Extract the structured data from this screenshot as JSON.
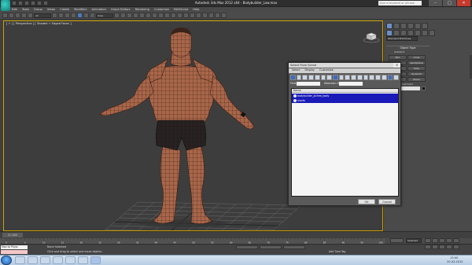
{
  "app": {
    "title": "Autodesk 3ds Max 2012 x64  -  Bodybuilder_Low.max",
    "search_placeholder": "Type a keyword or phrase"
  },
  "window_buttons": [
    "–",
    "□",
    "✕"
  ],
  "menu": [
    "Edit",
    "Tools",
    "Group",
    "Views",
    "Create",
    "Modifiers",
    "Animation",
    "Graph Editors",
    "Rendering",
    "Customize",
    "MAXScript",
    "Help"
  ],
  "toolbar": {
    "selection_filter": "All",
    "view_drop": "View"
  },
  "viewport": {
    "label": "[ + ] [ Perspective ] [ Shaded + Edged Faces ]"
  },
  "command_panel": {
    "dropdown": "Standard Primitives",
    "rollout": "Object Type",
    "autogrid": "AutoGrid",
    "buttons": [
      [
        "Box",
        "Cone"
      ],
      [
        "Sphere",
        "GeoSphere"
      ],
      [
        "Cylinder",
        "Tube"
      ],
      [
        "Torus",
        "Pyramid"
      ],
      [
        "Teapot",
        "Plane"
      ]
    ],
    "name_color": "Name and Color"
  },
  "dialog": {
    "title": "Select From Scene",
    "menu": [
      "Select",
      "Display",
      "Customize"
    ],
    "find_label": "Find:",
    "selection_set_label": "Selection Set:",
    "column": "Name",
    "rows": [
      "bodybuilder_jd.free_body",
      "shorts"
    ],
    "ok": "OK",
    "cancel": "Cancel"
  },
  "timeline": {
    "frame": "0 / 100",
    "ticks": [
      "0",
      "5",
      "10",
      "15",
      "20",
      "25",
      "30",
      "35",
      "40",
      "45",
      "50",
      "55",
      "60",
      "65",
      "70",
      "75",
      "80",
      "85",
      "90",
      "95",
      "100"
    ]
  },
  "status": {
    "maxscript": "Max to Physc",
    "selection": "None Selected",
    "hint": "Click and drag to select and move objects",
    "add_time_tag": "Add Time Tag",
    "selected": "Selected"
  },
  "clock": {
    "time": "13:00",
    "date": "20.02.2012"
  }
}
